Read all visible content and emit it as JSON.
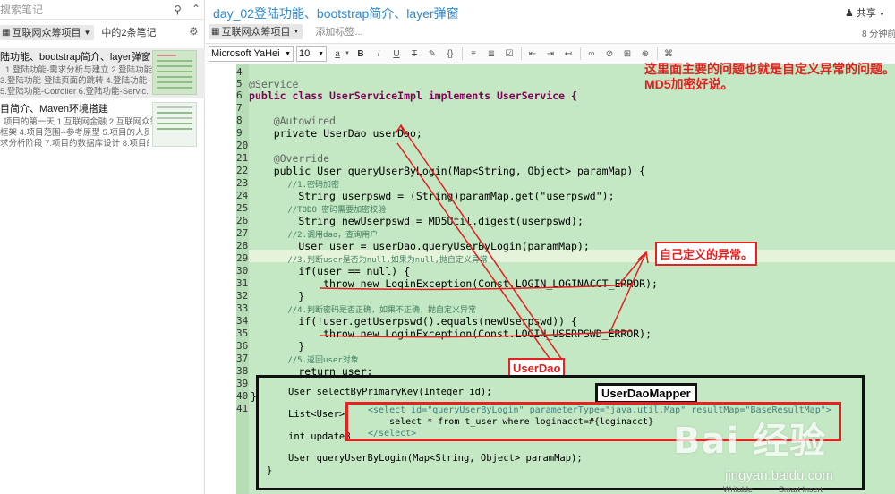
{
  "sidebar": {
    "search_placeholder": "搜索笔记",
    "notebook_label": "互联网众筹项目",
    "notebook_count": "中的2条笔记",
    "notes": [
      {
        "title": "陆功能、bootstrap简介、layer弹窗",
        "lines": [
          "1.登陆功能-需求分析与建立 2.登陆功能-建",
          "3.登陆功能-登陆页面的跳转 4.登陆功能-表",
          "5.登陆功能-Cotroller 6.登陆功能-Servic..."
        ]
      },
      {
        "title": "目简介、Maven环境搭建",
        "lines": [
          "项目的第一天 1.互联网金融 2.互联网众筹",
          "框架 4.项目范围--参考原型 5.项目的人员组",
          "求分析阶段 7.项目的数据库设计 8.项目的..."
        ]
      }
    ]
  },
  "header": {
    "doc_title": "day_02登陆功能、bootstrap简介、layer弹窗",
    "share_label": "共享",
    "notebook_tag": "互联网众筹项目",
    "add_tag": "添加标签...",
    "time_ago": "8 分钟前"
  },
  "toolbar": {
    "font_family": "Microsoft YaHei",
    "font_size": "10"
  },
  "code": {
    "line_numbers": [
      "4",
      "5",
      "6",
      "7",
      "8",
      "9",
      "20",
      "21",
      "22",
      "23",
      "24",
      "25",
      "26",
      "27",
      "28",
      "29",
      "30",
      "31",
      "32",
      "33",
      "34",
      "35",
      "36",
      "37",
      "38",
      "39",
      "40",
      "41"
    ],
    "lines": {
      "l4": "",
      "l5": "@Service",
      "l6": "public class UserServiceImpl implements UserService {",
      "l8": "    @Autowired",
      "l9": "    private UserDao userDao;",
      "l21": "    @Override",
      "l22": "    public User queryUserByLogin(Map<String, Object> paramMap) {",
      "l23": "        //1.密码加密",
      "l24": "        String userpswd = (String)paramMap.get(\"userpswd\");",
      "l25": "        //TODO 密码需要加密校验",
      "l26": "        String newUserpswd = MD5Util.digest(userpswd);",
      "l27": "        //2.调用dao，查询用户",
      "l28": "        User user = userDao.queryUserByLogin(paramMap);",
      "l29": "        //3.判断user是否为null,如果为null,抛自定义异常",
      "l30": "        if(user == null) {",
      "l31": "            throw new LoginException(Const.LOGIN_LOGINACCT_ERROR);",
      "l32": "        }",
      "l33": "        //4.判断密码是否正确，如果不正确，抛自定义异常",
      "l34": "        if(!user.getUserpswd().equals(newUserpswd)) {",
      "l35": "            throw new LoginException(Const.LOGIN_USERPSWD_ERROR);",
      "l36": "        }",
      "l37": "        //5.返回user对象",
      "l38": "        return user;",
      "l40": "}"
    },
    "mapper_lines": {
      "m1": "User selectByPrimaryKey(Integer id);",
      "m2": "List<User>",
      "m3": "int updateB",
      "m4": "User queryUserByLogin(Map<String, Object> paramMap);",
      "m5": "}"
    },
    "xml_lines": {
      "x1": "<select id=\"queryUserByLogin\" parameterType=\"java.util.Map\" resultMap=\"BaseResultMap\">",
      "x2": "    select * from t_user where loginacct=#{loginacct}",
      "x3": "</select>"
    }
  },
  "annotations": {
    "top_note_1": "这里面主要的问题也就是自定义异常的问题。",
    "top_note_2": "MD5加密好说。",
    "exception_label": "自己定义的异常。",
    "userdao_label": "UserDao",
    "mapper_label": "UserDaoMapper"
  },
  "watermark": {
    "brand": "Bai 经验",
    "url": "jingyan.baidu.com"
  },
  "status_bar": {
    "writable": "Writable",
    "insert": "Smart Insert"
  },
  "colors": {
    "code_bg": "#c4e8c4",
    "title_blue": "#2f8ad0",
    "annotation_red": "#e02020"
  }
}
